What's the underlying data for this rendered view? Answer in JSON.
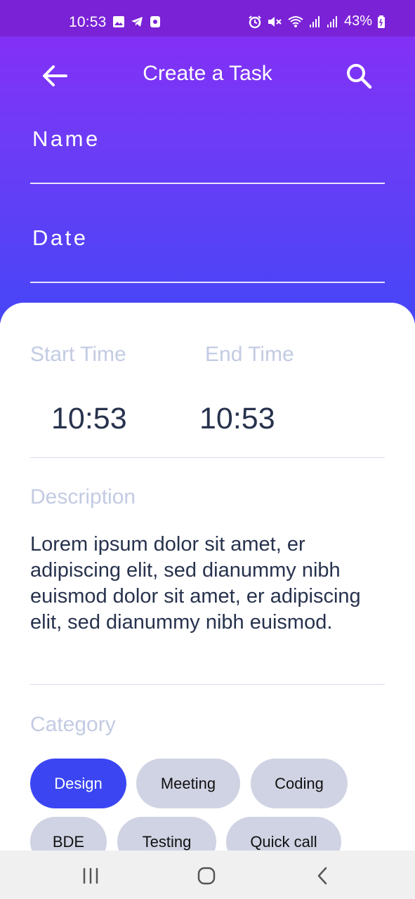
{
  "status_bar": {
    "time": "10:53",
    "battery": "43%",
    "icons": [
      "image-icon",
      "telegram-icon",
      "app-icon",
      "alarm-icon",
      "mute-icon",
      "wifi-icon",
      "signal-icon",
      "signal-icon",
      "battery-icon"
    ]
  },
  "appbar": {
    "title": "Create a Task",
    "back_icon": "arrow-back-icon",
    "search_icon": "search-icon"
  },
  "form": {
    "name_label": "Name",
    "date_label": "Date"
  },
  "times": {
    "start_label": "Start Time",
    "start_value": "10:53",
    "end_label": "End Time",
    "end_value": "10:53"
  },
  "description": {
    "label": "Description",
    "text": "Lorem ipsum dolor sit amet, er adipiscing elit, sed dianummy nibh euismod dolor sit amet, er adipiscing elit, sed dianummy nibh euismod."
  },
  "category": {
    "label": "Category",
    "chips": [
      {
        "label": "Design",
        "selected": true
      },
      {
        "label": "Meeting",
        "selected": false
      },
      {
        "label": "Coding",
        "selected": false
      },
      {
        "label": "BDE",
        "selected": false
      },
      {
        "label": "Testing",
        "selected": false
      },
      {
        "label": "Quick call",
        "selected": false
      }
    ]
  },
  "colors": {
    "gradient_top": "#8b2cf5",
    "gradient_bottom": "#4646f7",
    "accent": "#3b46f2",
    "chip_bg": "#d0d3e3",
    "muted_text": "#c3cbe3",
    "dark_text": "#27324d"
  },
  "nav_bar": {
    "icons": [
      "recent-apps-icon",
      "home-icon",
      "back-icon"
    ]
  }
}
